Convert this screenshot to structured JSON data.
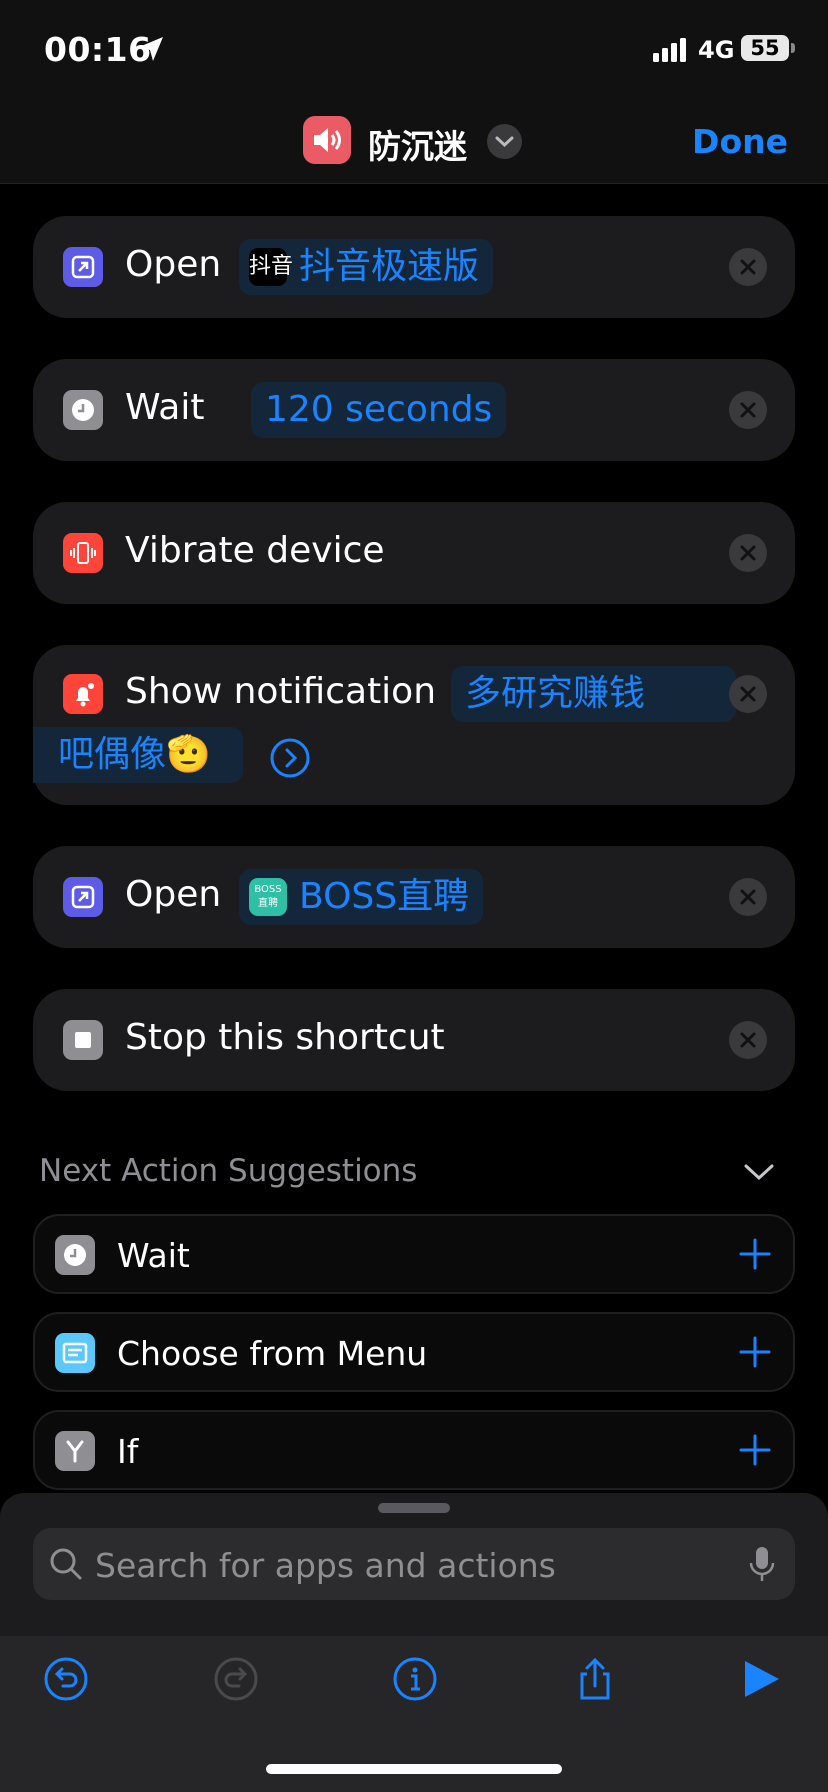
{
  "status_bar": {
    "time": "00:16",
    "network": "4G",
    "battery": "55"
  },
  "nav": {
    "title": "防沉迷",
    "done_label": "Done"
  },
  "actions": [
    {
      "label": "Open",
      "token": "抖音极速版"
    },
    {
      "label": "Wait",
      "token": "120 seconds"
    },
    {
      "label": "Vibrate device"
    },
    {
      "label": "Show notification",
      "token_line1": "多研究赚钱",
      "token_line2": "吧偶像🫡"
    },
    {
      "label": "Open",
      "token": "BOSS直聘"
    },
    {
      "label": "Stop this shortcut"
    }
  ],
  "app_icons": {
    "tiktok_icon": "抖音",
    "boss_badge_top": "BOSS",
    "boss_badge_bottom": "直聘"
  },
  "suggestions": {
    "title": "Next Action Suggestions",
    "items": [
      {
        "label": "Wait"
      },
      {
        "label": "Choose from Menu"
      },
      {
        "label": "If"
      }
    ]
  },
  "search": {
    "placeholder": "Search for apps and actions"
  },
  "colors": {
    "accent": "#1a84ff",
    "card": "#1c1c1e",
    "app_icon": "#ea5b66",
    "open_icon": "#5e5ce6",
    "alert_icon": "#ff453a",
    "menu_icon": "#5ac8fa"
  }
}
